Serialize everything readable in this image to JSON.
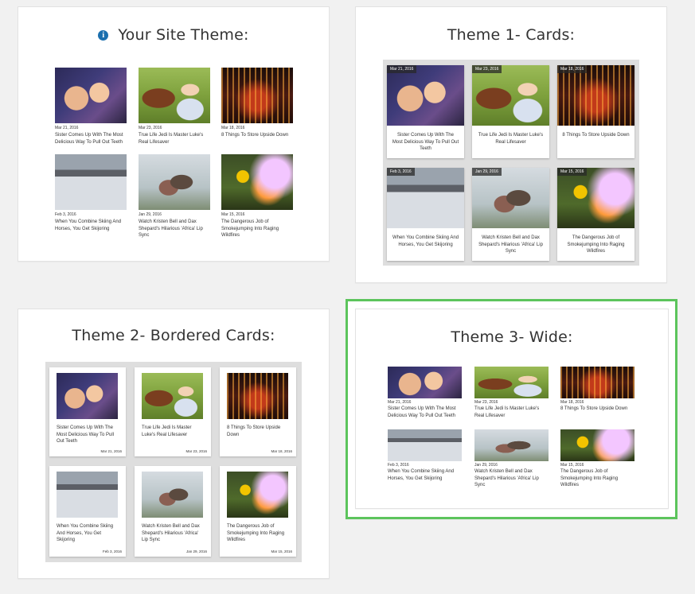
{
  "panels": {
    "site": {
      "title": "Your Site Theme:"
    },
    "cards": {
      "title": "Theme 1- Cards:"
    },
    "bordered": {
      "title": "Theme 2- Bordered Cards:"
    },
    "wide": {
      "title": "Theme 3- Wide:"
    }
  },
  "colors": {
    "selected_border": "#5cc45c",
    "info_icon": "#1b6fae"
  },
  "icons": {
    "info": "info-icon"
  },
  "posts": [
    {
      "date": "Mar 21, 2016",
      "title": "Sister Comes Up With The Most Delicious Way To Pull Out Teeth",
      "image": "kid-with-candy"
    },
    {
      "date": "Mar 23, 2016",
      "title": "True Life Jedi Is Master Luke's Real Lifesaver",
      "image": "kid-with-ewok"
    },
    {
      "date": "Mar 18, 2016",
      "title": "8 Things To Store Upside Down",
      "image": "red-lights"
    },
    {
      "date": "Feb 3, 2016",
      "title": "When You Combine Skiing And Horses, You Get Skijoring",
      "image": "skijoring"
    },
    {
      "date": "Jan 29, 2016",
      "title": "Watch Kristen Bell and Dax Shepard's Hilarious 'Africa' Lip Sync",
      "image": "couple"
    },
    {
      "date": "Mar 15, 2016",
      "title": "The Dangerous Job of Smokejumping Into Raging Wildfires",
      "image": "wildfire"
    }
  ]
}
